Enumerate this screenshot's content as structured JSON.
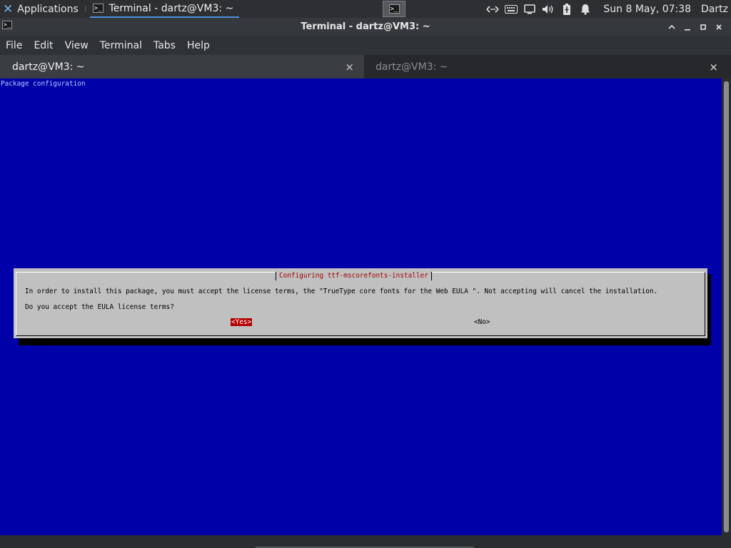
{
  "panel": {
    "applications_label": "Applications",
    "task_title": "Terminal - dartz@VM3: ~",
    "term_glyph": ">_",
    "clock": "Sun  8 May, 07:38",
    "user": "Dartz",
    "icons": [
      "applications-logo-icon",
      "terminal-launcher-icon",
      "network-icon",
      "keyboard-icon",
      "display-icon",
      "volume-icon",
      "battery-icon",
      "notifications-bell-icon"
    ]
  },
  "window": {
    "title": "Terminal - dartz@VM3: ~",
    "menu": [
      "File",
      "Edit",
      "View",
      "Terminal",
      "Tabs",
      "Help"
    ],
    "tabs": [
      {
        "label": "dartz@VM3: ~",
        "active": true
      },
      {
        "label": "dartz@VM3: ~",
        "active": false
      }
    ],
    "tab_close": "×"
  },
  "terminal": {
    "header": "Package configuration",
    "dialog": {
      "title": "Configuring ttf-mscorefonts-installer",
      "message": "In order to install this package, you must accept the license terms, the \"TrueType core fonts for the Web EULA \". Not accepting will cancel the installation.",
      "question": "Do you accept the EULA license terms?",
      "yes": "<Yes>",
      "no": "<No>"
    }
  },
  "colors": {
    "terminal_bg": "#0000a8",
    "dialog_bg": "#c0c0c0",
    "dialog_title": "#a30000",
    "selected_button": "#b40000",
    "accent": "#4a90d9"
  }
}
